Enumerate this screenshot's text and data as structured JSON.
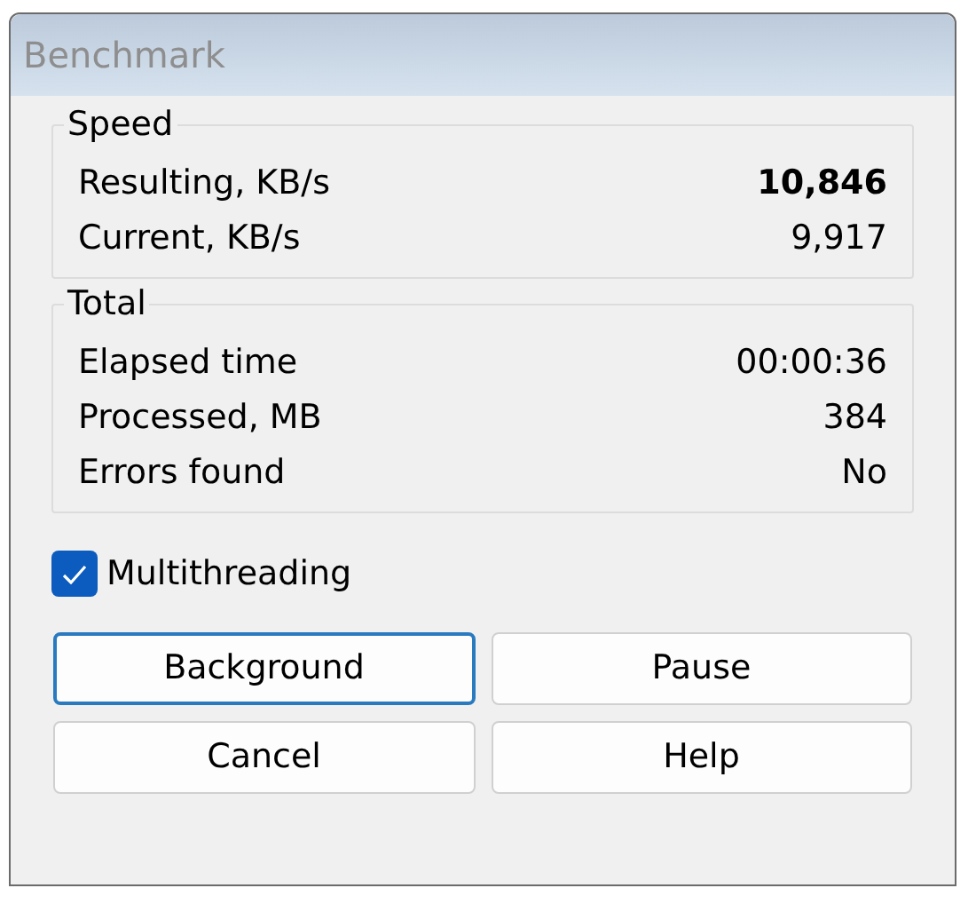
{
  "window": {
    "title": "Benchmark"
  },
  "groups": [
    {
      "title": "Speed",
      "rows": [
        {
          "label": "Resulting, KB/s",
          "value": "10,846",
          "emphasized": true
        },
        {
          "label": "Current, KB/s",
          "value": "9,917",
          "emphasized": false
        }
      ]
    },
    {
      "title": "Total",
      "rows": [
        {
          "label": "Elapsed time",
          "value": "00:00:36",
          "emphasized": false
        },
        {
          "label": "Processed, MB",
          "value": "384",
          "emphasized": false
        },
        {
          "label": "Errors found",
          "value": "No",
          "emphasized": false
        }
      ]
    }
  ],
  "checkbox": {
    "label": "Multithreading",
    "checked": true
  },
  "buttons": [
    {
      "label": "Background",
      "focused": true
    },
    {
      "label": "Pause",
      "focused": false
    },
    {
      "label": "Cancel",
      "focused": false
    },
    {
      "label": "Help",
      "focused": false
    }
  ]
}
